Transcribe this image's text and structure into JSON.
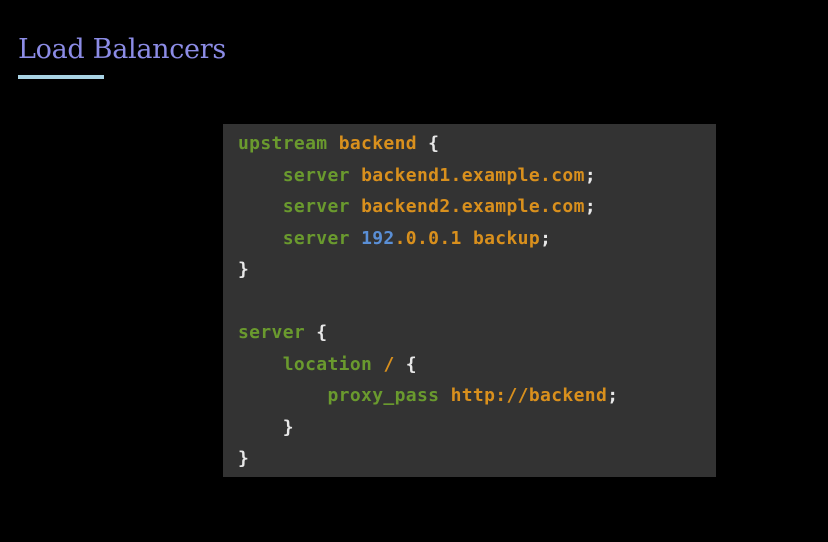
{
  "title": "Load Balancers",
  "colors": {
    "title": "#8c8ce6",
    "underline": "#a9d3e4",
    "code_background": "#333333",
    "keyword": "#6a9a2e",
    "value": "#d9901d",
    "number": "#5a8fd6",
    "punct": "#e8e8e8"
  },
  "code": [
    [
      {
        "t": "upstream",
        "c": "keyword"
      },
      {
        "t": " ",
        "c": "punct"
      },
      {
        "t": "backend",
        "c": "value"
      },
      {
        "t": " {",
        "c": "punct"
      }
    ],
    [
      {
        "t": "    ",
        "c": "punct"
      },
      {
        "t": "server",
        "c": "keyword"
      },
      {
        "t": " ",
        "c": "punct"
      },
      {
        "t": "backend1.example.com",
        "c": "value"
      },
      {
        "t": ";",
        "c": "punct"
      }
    ],
    [
      {
        "t": "    ",
        "c": "punct"
      },
      {
        "t": "server",
        "c": "keyword"
      },
      {
        "t": " ",
        "c": "punct"
      },
      {
        "t": "backend2.example.com",
        "c": "value"
      },
      {
        "t": ";",
        "c": "punct"
      }
    ],
    [
      {
        "t": "    ",
        "c": "punct"
      },
      {
        "t": "server",
        "c": "keyword"
      },
      {
        "t": " ",
        "c": "punct"
      },
      {
        "t": "192",
        "c": "number"
      },
      {
        "t": ".0.0.1",
        "c": "value"
      },
      {
        "t": " ",
        "c": "punct"
      },
      {
        "t": "backup",
        "c": "value"
      },
      {
        "t": ";",
        "c": "punct"
      }
    ],
    [
      {
        "t": "}",
        "c": "punct"
      }
    ],
    [],
    [
      {
        "t": "server",
        "c": "keyword"
      },
      {
        "t": " {",
        "c": "punct"
      }
    ],
    [
      {
        "t": "    ",
        "c": "punct"
      },
      {
        "t": "location",
        "c": "keyword"
      },
      {
        "t": " ",
        "c": "punct"
      },
      {
        "t": "/",
        "c": "value"
      },
      {
        "t": " {",
        "c": "punct"
      }
    ],
    [
      {
        "t": "        ",
        "c": "punct"
      },
      {
        "t": "proxy_pass",
        "c": "keyword"
      },
      {
        "t": " ",
        "c": "punct"
      },
      {
        "t": "http://backend",
        "c": "value"
      },
      {
        "t": ";",
        "c": "punct"
      }
    ],
    [
      {
        "t": "    }",
        "c": "punct"
      }
    ],
    [
      {
        "t": "}",
        "c": "punct"
      }
    ]
  ]
}
